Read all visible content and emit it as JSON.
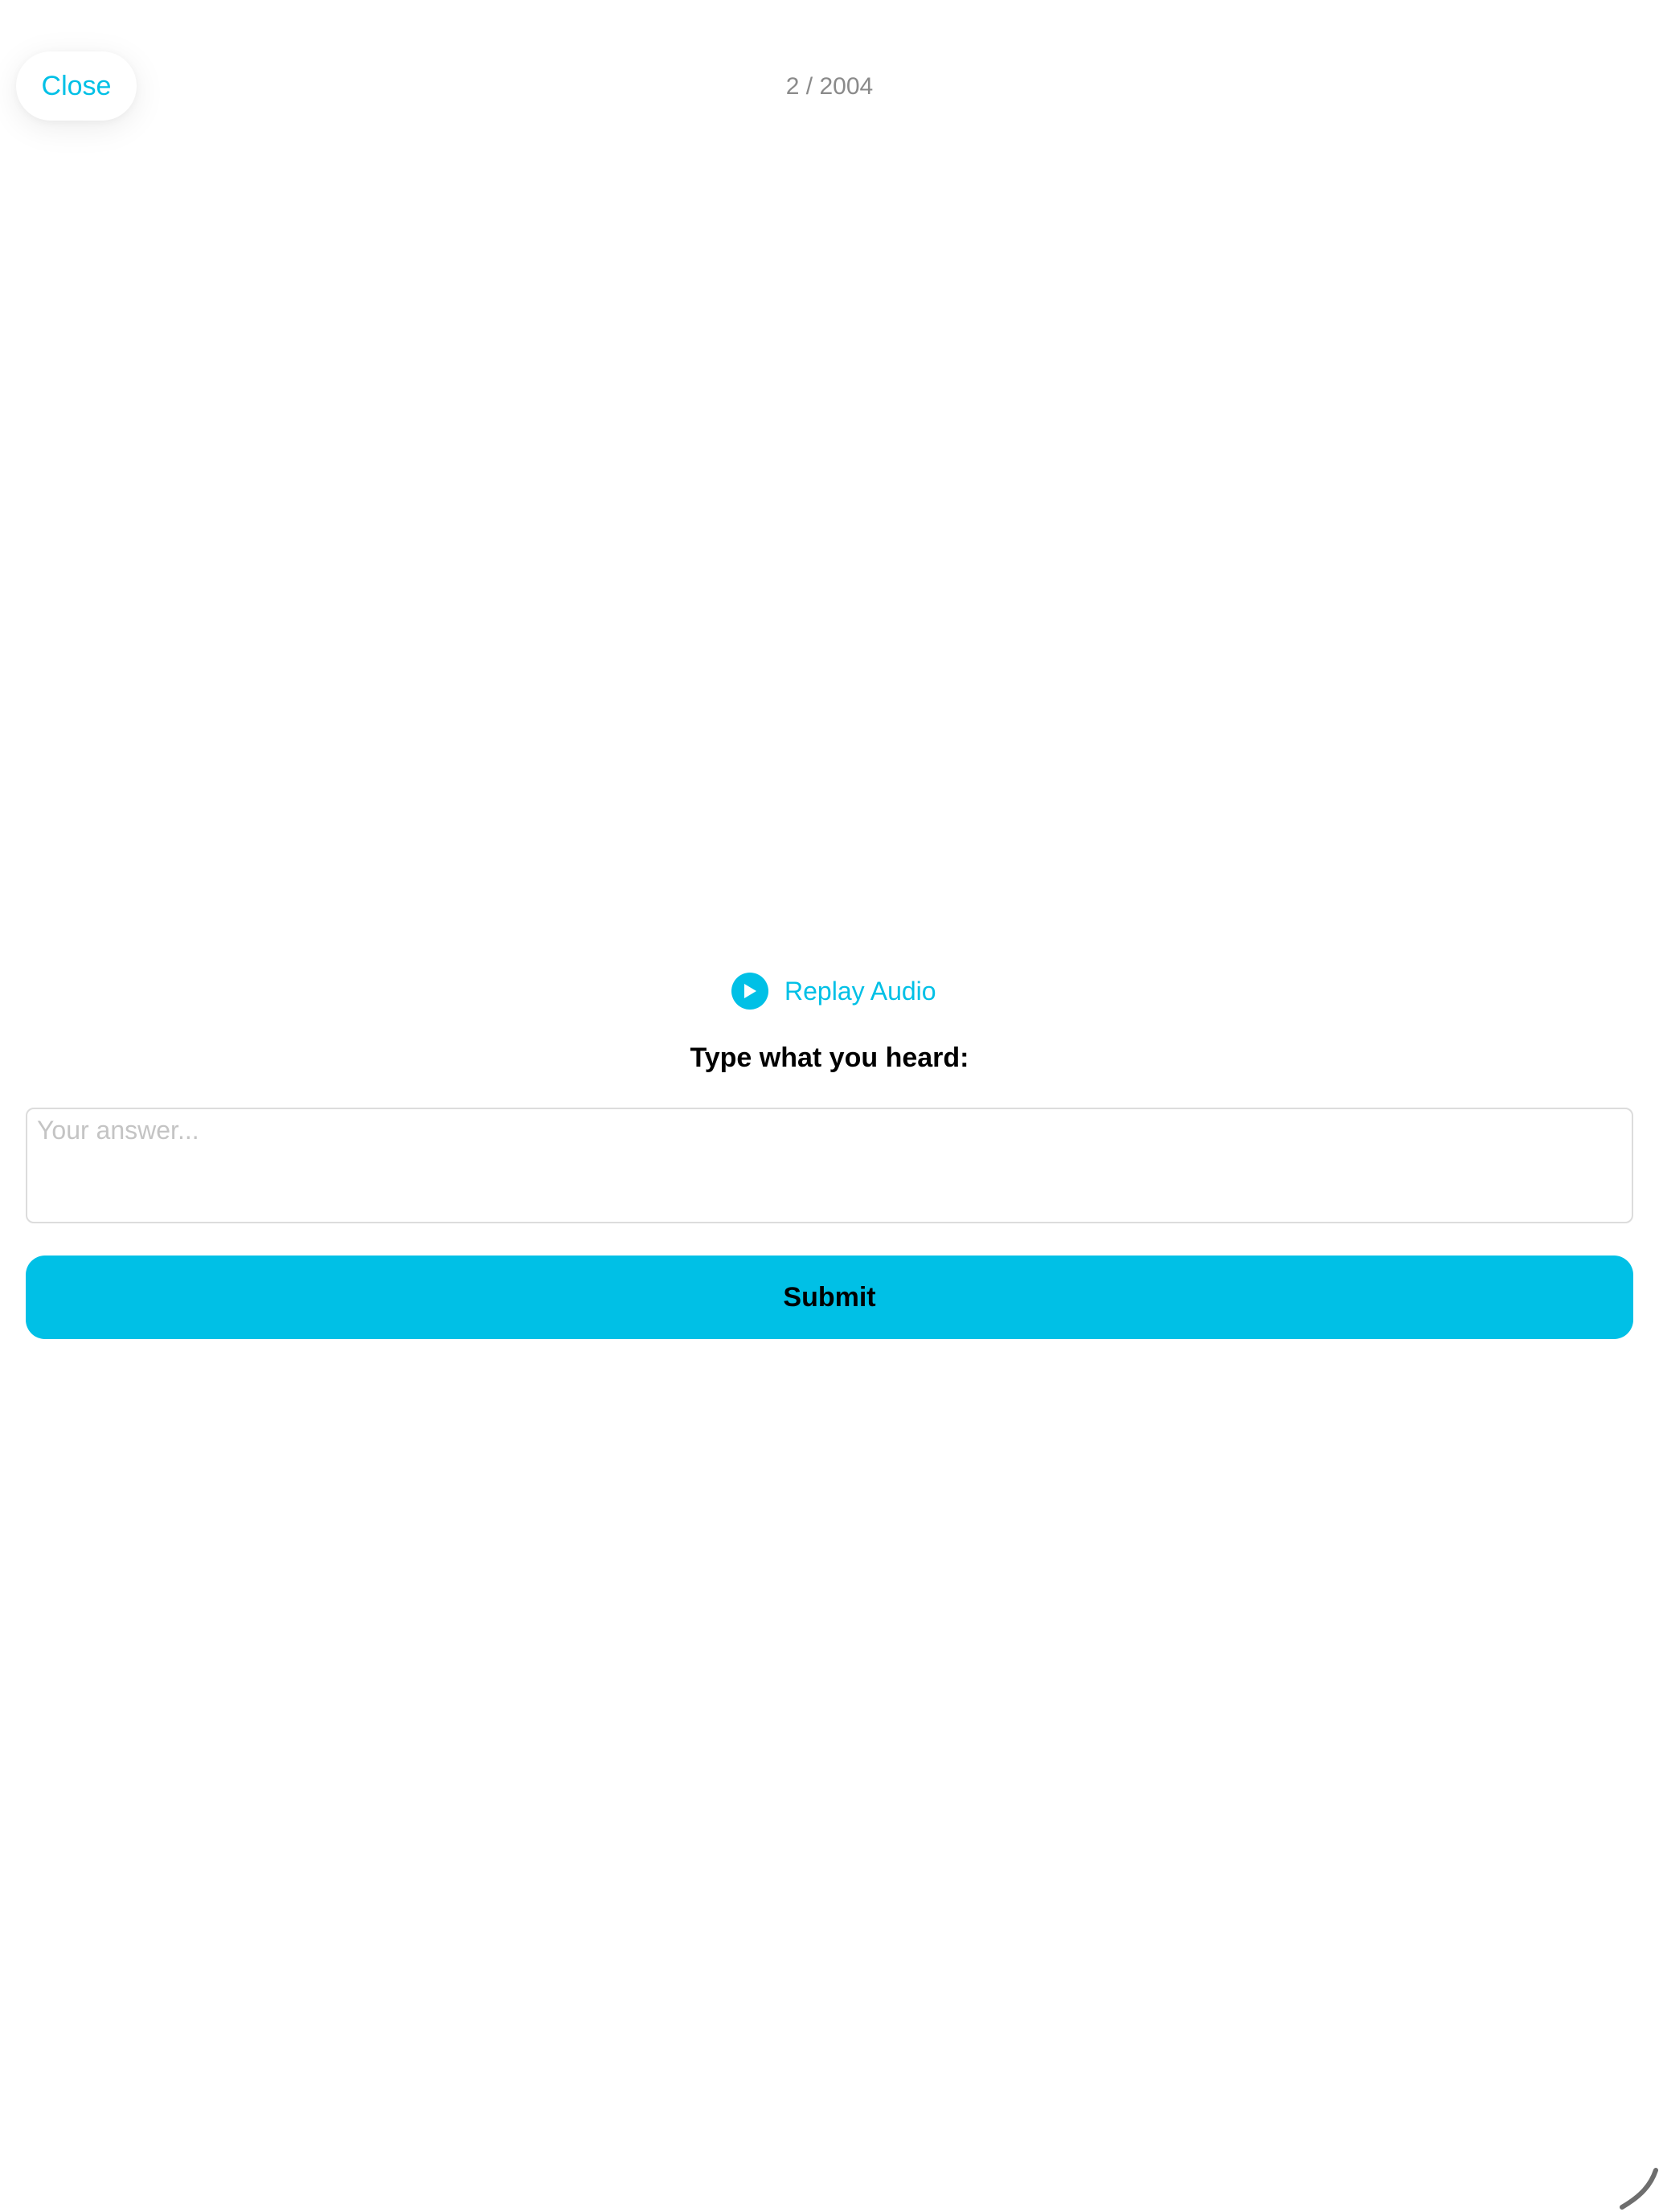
{
  "header": {
    "close_label": "Close",
    "progress": "2 / 2004"
  },
  "audio": {
    "replay_label": "Replay Audio",
    "icon": "play-circle-icon"
  },
  "question": {
    "prompt": "Type what you heard:"
  },
  "answer": {
    "value": "",
    "placeholder": "Your answer..."
  },
  "actions": {
    "submit_label": "Submit"
  },
  "colors": {
    "accent": "#00c0e6",
    "muted_text": "#8a8a8a",
    "placeholder": "#c4c4c4",
    "input_border": "#dcdcdc"
  }
}
